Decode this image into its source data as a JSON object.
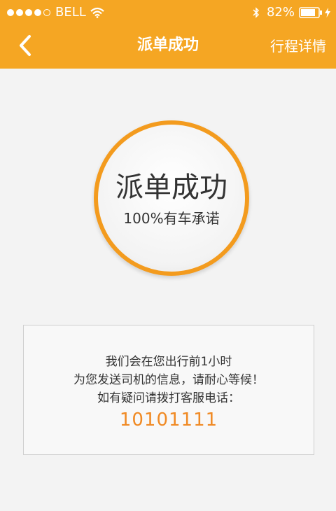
{
  "status_bar": {
    "carrier": "BELL",
    "battery": "82%",
    "signal_bars_filled": 4,
    "signal_bars_total": 5
  },
  "nav": {
    "title": "派单成功",
    "right_link": "行程详情"
  },
  "success": {
    "title": "派单成功",
    "subtitle": "100%有车承诺"
  },
  "info": {
    "line1": "我们会在您出行前1小时",
    "line2": "为您发送司机的信息，请耐心等候！",
    "line3": "如有疑问请拨打客服电话：",
    "phone": "10101111"
  },
  "colors": {
    "header_bg": "#f5a623",
    "accent": "#f08a24",
    "page_bg": "#f3f3f3"
  }
}
